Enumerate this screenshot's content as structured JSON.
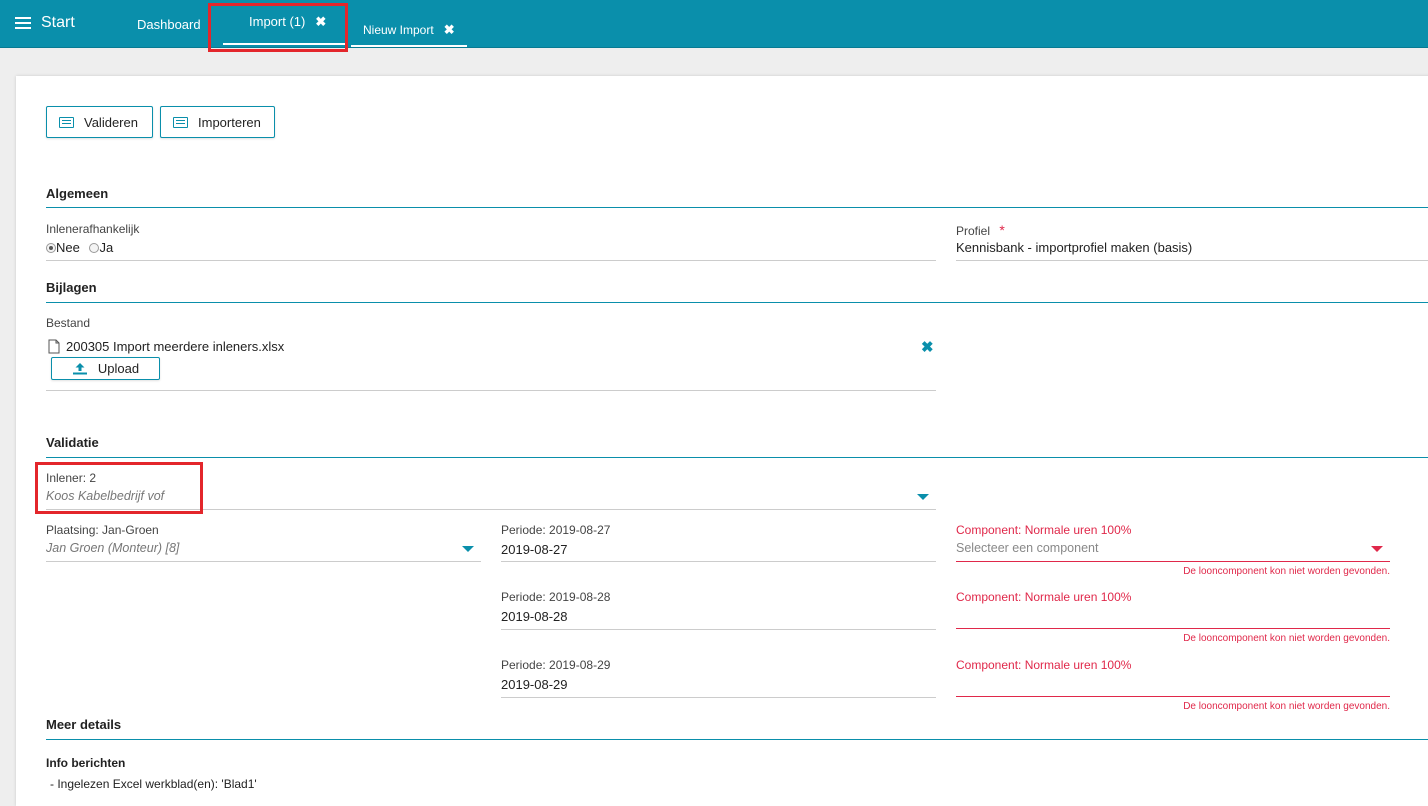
{
  "topbar": {
    "menu_label": "Start",
    "tabs": [
      {
        "label": "Dashboard"
      },
      {
        "label": "Import (1)",
        "close": "✖"
      },
      {
        "label": "Nieuw Import",
        "close": "✖"
      }
    ]
  },
  "toolbar": {
    "validate_label": "Valideren",
    "import_label": "Importeren"
  },
  "algemeen": {
    "title": "Algemeen",
    "inlenerafhankelijk_label": "Inlenerafhankelijk",
    "option_nee": "Nee",
    "option_ja": "Ja",
    "selected": "Nee",
    "profiel_label": "Profiel",
    "required_mark": "*",
    "profiel_value": "Kennisbank - importprofiel maken (basis)"
  },
  "bijlagen": {
    "title": "Bijlagen",
    "bestand_label": "Bestand",
    "file_name": "200305 Import meerdere inleners.xlsx",
    "upload_label": "Upload"
  },
  "validatie": {
    "title": "Validatie",
    "inlener_label": "Inlener: 2",
    "inlener_value": "Koos Kabelbedrijf vof",
    "plaatsing_label": "Plaatsing: Jan-Groen",
    "plaatsing_value": "Jan Groen (Monteur) [8]",
    "periods": [
      {
        "label": "Periode: 2019-08-27",
        "value": "2019-08-27",
        "component_label": "Component: Normale uren 100%",
        "component_placeholder": "Selecteer een component",
        "error": "De looncomponent kon niet worden gevonden."
      },
      {
        "label": "Periode: 2019-08-28",
        "value": "2019-08-28",
        "component_label": "Component: Normale uren 100%",
        "component_placeholder": "",
        "error": "De looncomponent kon niet worden gevonden."
      },
      {
        "label": "Periode: 2019-08-29",
        "value": "2019-08-29",
        "component_label": "Component: Normale uren 100%",
        "component_placeholder": "",
        "error": "De looncomponent kon niet worden gevonden."
      }
    ]
  },
  "meer_details": {
    "title": "Meer details",
    "info_title": "Info berichten",
    "info_line": "- Ingelezen Excel werkblad(en): 'Blad1'"
  },
  "colors": {
    "accent": "#0a8fab",
    "error": "#e0284a",
    "highlight": "#e3262b"
  }
}
